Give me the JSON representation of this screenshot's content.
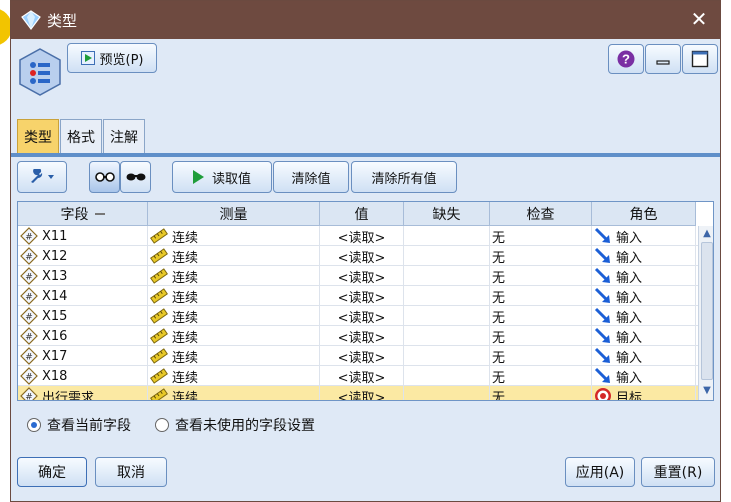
{
  "window": {
    "title": "类型",
    "close_glyph": "✕"
  },
  "toolbar_top": {
    "preview_label": "预览(P)",
    "help_glyph": "?"
  },
  "tabs": [
    {
      "label": "类型"
    },
    {
      "label": "格式"
    },
    {
      "label": "注解"
    }
  ],
  "toolbar": {
    "read_label": "读取值",
    "clear_label": "清除值",
    "clear_all_label": "清除所有值"
  },
  "table": {
    "headers": [
      "字段",
      "测量",
      "值",
      "缺失",
      "检查",
      "角色"
    ],
    "rows": [
      {
        "field": "X11",
        "measure": "连续",
        "value": "<读取>",
        "missing": "",
        "check": "无",
        "role": "输入"
      },
      {
        "field": "X12",
        "measure": "连续",
        "value": "<读取>",
        "missing": "",
        "check": "无",
        "role": "输入"
      },
      {
        "field": "X13",
        "measure": "连续",
        "value": "<读取>",
        "missing": "",
        "check": "无",
        "role": "输入"
      },
      {
        "field": "X14",
        "measure": "连续",
        "value": "<读取>",
        "missing": "",
        "check": "无",
        "role": "输入"
      },
      {
        "field": "X15",
        "measure": "连续",
        "value": "<读取>",
        "missing": "",
        "check": "无",
        "role": "输入"
      },
      {
        "field": "X16",
        "measure": "连续",
        "value": "<读取>",
        "missing": "",
        "check": "无",
        "role": "输入"
      },
      {
        "field": "X17",
        "measure": "连续",
        "value": "<读取>",
        "missing": "",
        "check": "无",
        "role": "输入"
      },
      {
        "field": "X18",
        "measure": "连续",
        "value": "<读取>",
        "missing": "",
        "check": "无",
        "role": "输入"
      },
      {
        "field": "出行需求",
        "measure": "连续",
        "value": "<读取>",
        "missing": "",
        "check": "无",
        "role": "目标"
      }
    ]
  },
  "options": {
    "current_fields": "查看当前字段",
    "unused_fields": "查看未使用的字段设置"
  },
  "footer": {
    "ok": "确定",
    "cancel": "取消",
    "apply": "应用(A)",
    "reset": "重置(R)"
  },
  "colors": {
    "titlebar": "#6e4a40",
    "accent": "#5f8fc9",
    "selected_row": "#fbe9a3"
  }
}
